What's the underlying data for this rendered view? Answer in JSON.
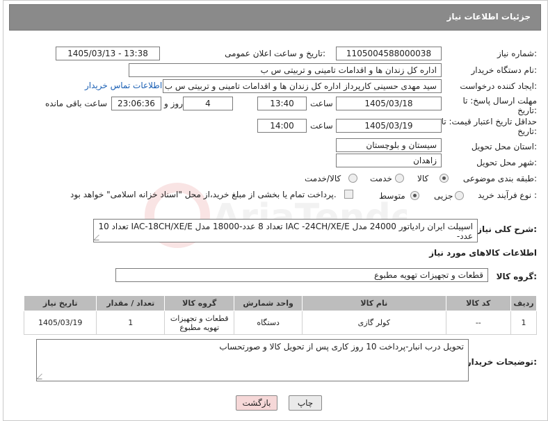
{
  "header": {
    "title": "جزئیات اطلاعات نیاز"
  },
  "need_number": {
    "label": "شماره نیاز:",
    "value": "1105004588000038"
  },
  "announce": {
    "label": "تاریخ و ساعت اعلان عمومی:",
    "value": "1405/03/13 - 13:38"
  },
  "buyer_org": {
    "label": "نام دستگاه خریدار:",
    "value": "اداره کل زندان ها و اقدامات تامینی و تربیتی س ب"
  },
  "requester": {
    "label": "ایجاد کننده درخواست:",
    "value": "سید مهدی حسینی کارپرداز اداره کل زندان ها و اقدامات تامینی و تربیتی س ب",
    "contact_link": "اطلاعات تماس خریدار"
  },
  "deadline": {
    "label": "مهلت ارسال پاسخ: تا تاریخ:",
    "date": "1405/03/18",
    "time_label": "ساعت",
    "time": "13:40",
    "days": "4",
    "days_label": "روز و",
    "remaining": "23:06:36",
    "remaining_label": "ساعت باقی مانده"
  },
  "price_validity": {
    "label": "حداقل تاریخ اعتبار قیمت: تا تاریخ:",
    "date": "1405/03/19",
    "time_label": "ساعت",
    "time": "14:00"
  },
  "province": {
    "label": "استان محل تحویل:",
    "value": "سیستان و بلوچستان"
  },
  "city": {
    "label": "شهر محل تحویل:",
    "value": "زاهدان"
  },
  "category": {
    "label": "طبقه بندی موضوعی:",
    "options": [
      "کالا",
      "خدمت",
      "کالا/خدمت"
    ],
    "selected": "کالا"
  },
  "process": {
    "label": "نوع فرآیند خرید :",
    "options": [
      "جزیی",
      "متوسط"
    ],
    "selected": "متوسط",
    "payment_note": "پرداخت تمام یا بخشی از مبلغ خرید،از محل \"اسناد خزانه اسلامی\" خواهد بود."
  },
  "description": {
    "label": "شرح کلی نیاز:",
    "value": "اسپیلت ایران رادیاتور 24000 مدل IAC -24CH/XE/E تعداد 8 عدد-18000 مدل IAC-18CH/XE/E تعداد 10 عدد-"
  },
  "goods_info_title": "اطلاعات کالاهای مورد نیاز",
  "goods_group": {
    "label": "گروه کالا:",
    "value": "قطعات و تجهیزات تهویه مطبوع"
  },
  "table": {
    "headers": [
      "ردیف",
      "کد کالا",
      "نام کالا",
      "واحد شمارش",
      "گروه کالا",
      "تعداد / مقدار",
      "تاریخ نیاز"
    ],
    "rows": [
      {
        "row": "1",
        "code": "--",
        "name": "کولر گازی",
        "unit": "دستگاه",
        "group": "قطعات و تجهیزات تهویه مطبوع",
        "qty": "1",
        "date": "1405/03/19"
      }
    ]
  },
  "buyer_notes": {
    "label": "توضیحات خریدار:",
    "value": "تحویل درب انبار-پرداخت 10 روز کاری پس از تحویل کالا و صورتحساب"
  },
  "buttons": {
    "print": "چاپ",
    "back": "بازگشت"
  },
  "watermark": {
    "text": "AriaTender.net"
  }
}
